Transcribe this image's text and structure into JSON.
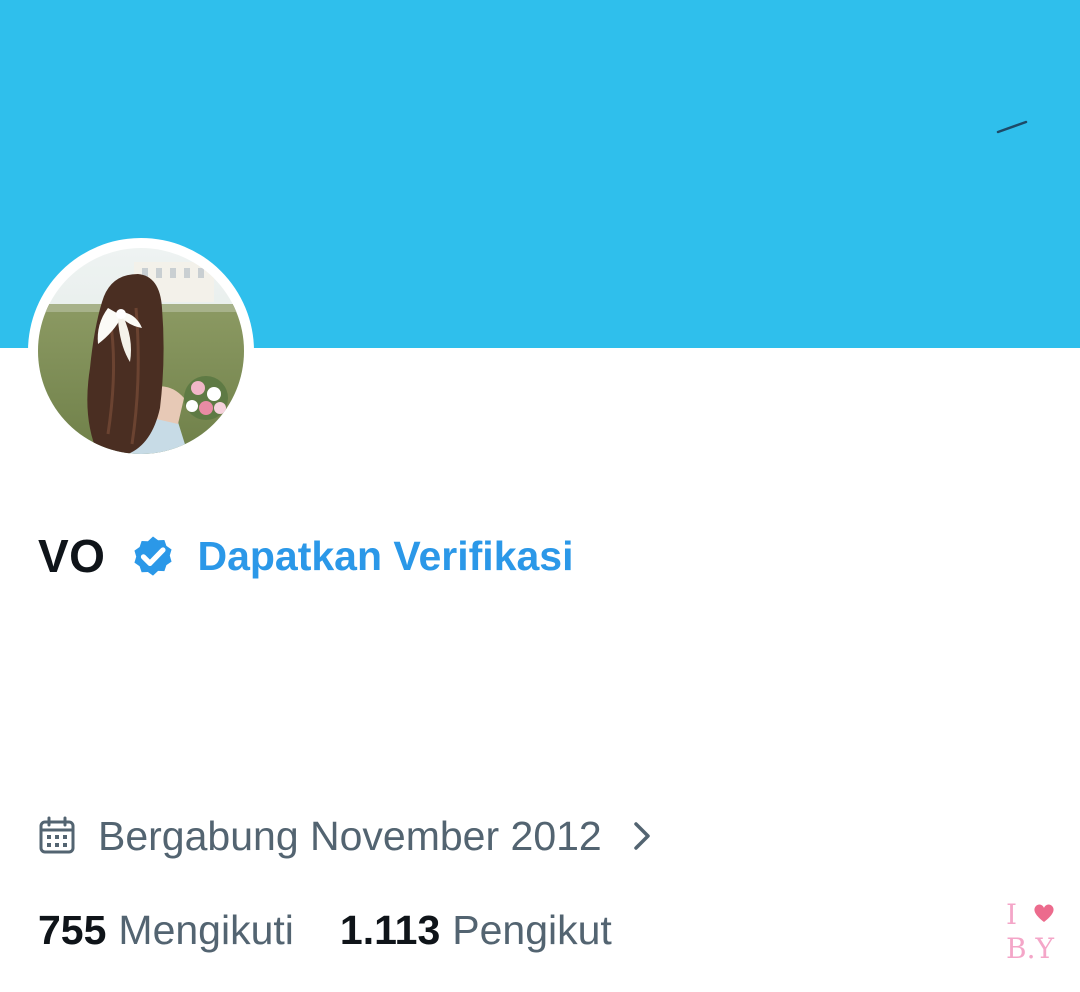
{
  "profile": {
    "name": "VO",
    "get_verified_label": "Dapatkan Verifikasi",
    "joined_text": "Bergabung November 2012",
    "following_count": "755",
    "following_label": "Mengikuti",
    "followers_count": "1.113",
    "followers_label": "Pengikut"
  },
  "watermark": {
    "text": "I ♥ B.Y"
  },
  "icons": {
    "verified": "verified-badge-icon",
    "calendar": "calendar-icon",
    "chevron": "chevron-right-icon"
  },
  "colors": {
    "banner": "#2fbfec",
    "accent": "#2b98e8",
    "text_primary": "#0f1419",
    "text_secondary": "#536471",
    "watermark": "#f4a6c8"
  }
}
